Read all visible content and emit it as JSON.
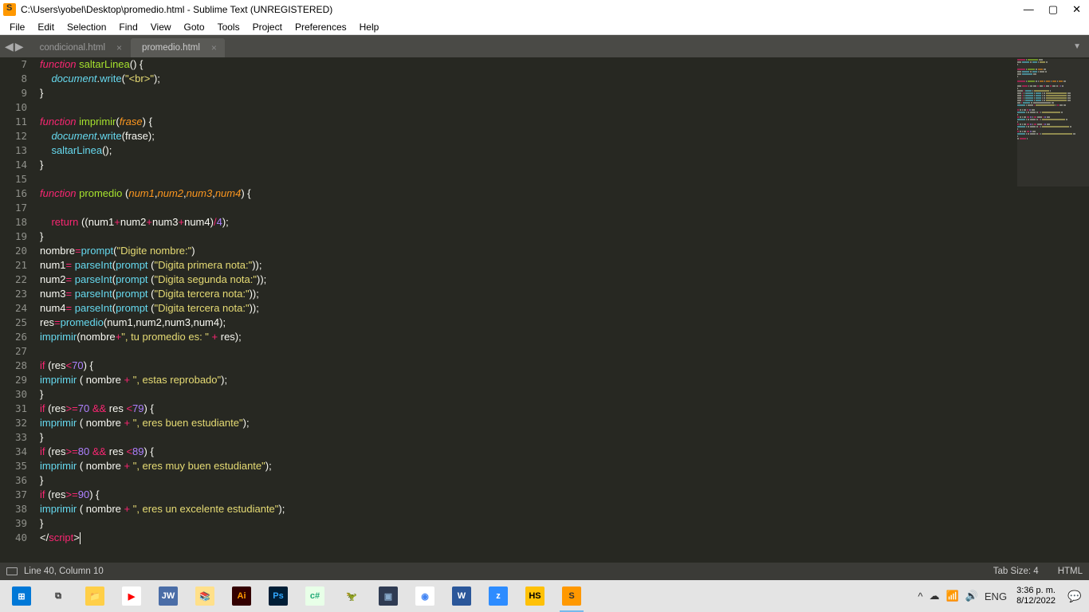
{
  "window": {
    "title": "C:\\Users\\yobel\\Desktop\\promedio.html - Sublime Text (UNREGISTERED)"
  },
  "menu": [
    "File",
    "Edit",
    "Selection",
    "Find",
    "View",
    "Goto",
    "Tools",
    "Project",
    "Preferences",
    "Help"
  ],
  "tabs": [
    {
      "label": "condicional.html",
      "active": false
    },
    {
      "label": "promedio.html",
      "active": true
    }
  ],
  "gutter_start": 7,
  "gutter_end": 40,
  "code_lines": [
    [
      [
        "kw",
        "function"
      ],
      [
        "var",
        " "
      ],
      [
        "fnname",
        "saltarLinea"
      ],
      [
        "paren",
        "() {"
      ]
    ],
    [
      [
        "var",
        "    "
      ],
      [
        "obj",
        "document"
      ],
      [
        "var",
        "."
      ],
      [
        "fn",
        "write"
      ],
      [
        "paren",
        "("
      ],
      [
        "str",
        "\"<br>\""
      ],
      [
        "paren",
        ");"
      ]
    ],
    [
      [
        "paren",
        "}"
      ]
    ],
    [],
    [
      [
        "kw",
        "function"
      ],
      [
        "var",
        " "
      ],
      [
        "fnname",
        "imprimir"
      ],
      [
        "paren",
        "("
      ],
      [
        "param",
        "frase"
      ],
      [
        "paren",
        ") {"
      ]
    ],
    [
      [
        "var",
        "    "
      ],
      [
        "obj",
        "document"
      ],
      [
        "var",
        "."
      ],
      [
        "fn",
        "write"
      ],
      [
        "paren",
        "("
      ],
      [
        "var",
        "frase"
      ],
      [
        "paren",
        ");"
      ]
    ],
    [
      [
        "var",
        "    "
      ],
      [
        "fn",
        "saltarLinea"
      ],
      [
        "paren",
        "();"
      ]
    ],
    [
      [
        "paren",
        "}"
      ]
    ],
    [],
    [
      [
        "kw",
        "function"
      ],
      [
        "var",
        " "
      ],
      [
        "fnname",
        "promedio"
      ],
      [
        "var",
        " "
      ],
      [
        "paren",
        "("
      ],
      [
        "param",
        "num1"
      ],
      [
        "var",
        ","
      ],
      [
        "param",
        "num2"
      ],
      [
        "var",
        ","
      ],
      [
        "param",
        "num3"
      ],
      [
        "var",
        ","
      ],
      [
        "param",
        "num4"
      ],
      [
        "paren",
        ") {"
      ]
    ],
    [],
    [
      [
        "var",
        "    "
      ],
      [
        "kw2",
        "return"
      ],
      [
        "var",
        " "
      ],
      [
        "paren",
        "(("
      ],
      [
        "var",
        "num1"
      ],
      [
        "op",
        "+"
      ],
      [
        "var",
        "num2"
      ],
      [
        "op",
        "+"
      ],
      [
        "var",
        "num3"
      ],
      [
        "op",
        "+"
      ],
      [
        "var",
        "num4"
      ],
      [
        "paren",
        ")"
      ],
      [
        "op",
        "/"
      ],
      [
        "num",
        "4"
      ],
      [
        "paren",
        ");"
      ]
    ],
    [
      [
        "paren",
        "}"
      ]
    ],
    [
      [
        "var",
        "nombre"
      ],
      [
        "op",
        "="
      ],
      [
        "fn",
        "prompt"
      ],
      [
        "paren",
        "("
      ],
      [
        "str",
        "\"Digite nombre:\""
      ],
      [
        "paren",
        ")"
      ]
    ],
    [
      [
        "var",
        "num1"
      ],
      [
        "op",
        "="
      ],
      [
        "var",
        " "
      ],
      [
        "fn",
        "parseInt"
      ],
      [
        "paren",
        "("
      ],
      [
        "fn",
        "prompt"
      ],
      [
        "var",
        " "
      ],
      [
        "paren",
        "("
      ],
      [
        "str",
        "\"Digita primera nota:\""
      ],
      [
        "paren",
        "));"
      ]
    ],
    [
      [
        "var",
        "num2"
      ],
      [
        "op",
        "="
      ],
      [
        "var",
        " "
      ],
      [
        "fn",
        "parseInt"
      ],
      [
        "paren",
        "("
      ],
      [
        "fn",
        "prompt"
      ],
      [
        "var",
        " "
      ],
      [
        "paren",
        "("
      ],
      [
        "str",
        "\"Digita segunda nota:\""
      ],
      [
        "paren",
        "));"
      ]
    ],
    [
      [
        "var",
        "num3"
      ],
      [
        "op",
        "="
      ],
      [
        "var",
        " "
      ],
      [
        "fn",
        "parseInt"
      ],
      [
        "paren",
        "("
      ],
      [
        "fn",
        "prompt"
      ],
      [
        "var",
        " "
      ],
      [
        "paren",
        "("
      ],
      [
        "str",
        "\"Digita tercera nota:\""
      ],
      [
        "paren",
        "));"
      ]
    ],
    [
      [
        "var",
        "num4"
      ],
      [
        "op",
        "="
      ],
      [
        "var",
        " "
      ],
      [
        "fn",
        "parseInt"
      ],
      [
        "paren",
        "("
      ],
      [
        "fn",
        "prompt"
      ],
      [
        "var",
        " "
      ],
      [
        "paren",
        "("
      ],
      [
        "str",
        "\"Digita tercera nota:\""
      ],
      [
        "paren",
        "));"
      ]
    ],
    [
      [
        "var",
        "res"
      ],
      [
        "op",
        "="
      ],
      [
        "fn",
        "promedio"
      ],
      [
        "paren",
        "("
      ],
      [
        "var",
        "num1,num2,num3,num4"
      ],
      [
        "paren",
        ");"
      ]
    ],
    [
      [
        "fn",
        "imprimir"
      ],
      [
        "paren",
        "("
      ],
      [
        "var",
        "nombre"
      ],
      [
        "op",
        "+"
      ],
      [
        "str",
        "\", tu promedio es: \""
      ],
      [
        "var",
        " "
      ],
      [
        "op",
        "+"
      ],
      [
        "var",
        " res"
      ],
      [
        "paren",
        ");"
      ]
    ],
    [],
    [
      [
        "kw2",
        "if"
      ],
      [
        "var",
        " "
      ],
      [
        "paren",
        "("
      ],
      [
        "var",
        "res"
      ],
      [
        "op",
        "<"
      ],
      [
        "num",
        "70"
      ],
      [
        "paren",
        ") {"
      ]
    ],
    [
      [
        "fn",
        "imprimir"
      ],
      [
        "var",
        " "
      ],
      [
        "paren",
        "( "
      ],
      [
        "var",
        "nombre"
      ],
      [
        "var",
        " "
      ],
      [
        "op",
        "+"
      ],
      [
        "var",
        " "
      ],
      [
        "str",
        "\", estas reprobado\""
      ],
      [
        "paren",
        ");"
      ]
    ],
    [
      [
        "paren",
        "}"
      ]
    ],
    [
      [
        "kw2",
        "if"
      ],
      [
        "var",
        " "
      ],
      [
        "paren",
        "("
      ],
      [
        "var",
        "res"
      ],
      [
        "op",
        ">="
      ],
      [
        "num",
        "70"
      ],
      [
        "var",
        " "
      ],
      [
        "op",
        "&&"
      ],
      [
        "var",
        " res "
      ],
      [
        "op",
        "<"
      ],
      [
        "num",
        "79"
      ],
      [
        "paren",
        ") {"
      ]
    ],
    [
      [
        "fn",
        "imprimir"
      ],
      [
        "var",
        " "
      ],
      [
        "paren",
        "( "
      ],
      [
        "var",
        "nombre"
      ],
      [
        "var",
        " "
      ],
      [
        "op",
        "+"
      ],
      [
        "var",
        " "
      ],
      [
        "str",
        "\", eres buen estudiante\""
      ],
      [
        "paren",
        ");"
      ]
    ],
    [
      [
        "paren",
        "}"
      ]
    ],
    [
      [
        "kw2",
        "if"
      ],
      [
        "var",
        " "
      ],
      [
        "paren",
        "("
      ],
      [
        "var",
        "res"
      ],
      [
        "op",
        ">="
      ],
      [
        "num",
        "80"
      ],
      [
        "var",
        " "
      ],
      [
        "op",
        "&&"
      ],
      [
        "var",
        " res "
      ],
      [
        "op",
        "<"
      ],
      [
        "num",
        "89"
      ],
      [
        "paren",
        ") {"
      ]
    ],
    [
      [
        "fn",
        "imprimir"
      ],
      [
        "var",
        " "
      ],
      [
        "paren",
        "( "
      ],
      [
        "var",
        "nombre"
      ],
      [
        "var",
        " "
      ],
      [
        "op",
        "+"
      ],
      [
        "var",
        " "
      ],
      [
        "str",
        "\", eres muy buen estudiante\""
      ],
      [
        "paren",
        ");"
      ]
    ],
    [
      [
        "paren",
        "}"
      ]
    ],
    [
      [
        "kw2",
        "if"
      ],
      [
        "var",
        " "
      ],
      [
        "paren",
        "("
      ],
      [
        "var",
        "res"
      ],
      [
        "op",
        ">="
      ],
      [
        "num",
        "90"
      ],
      [
        "paren",
        ") {"
      ]
    ],
    [
      [
        "fn",
        "imprimir"
      ],
      [
        "var",
        " "
      ],
      [
        "paren",
        "( "
      ],
      [
        "var",
        "nombre"
      ],
      [
        "var",
        " "
      ],
      [
        "op",
        "+"
      ],
      [
        "var",
        " "
      ],
      [
        "str",
        "\", eres un excelente estudiante\""
      ],
      [
        "paren",
        ");"
      ]
    ],
    [
      [
        "paren",
        "}"
      ]
    ],
    [
      [
        "tagbr",
        "</"
      ],
      [
        "tag",
        "script"
      ],
      [
        "tagbr",
        ">"
      ],
      [
        "cursor",
        ""
      ]
    ]
  ],
  "status": {
    "left": "Line 40, Column 10",
    "tab_size": "Tab Size: 4",
    "syntax": "HTML"
  },
  "tray": {
    "lang": "ENG",
    "time": "3:36 p. m.",
    "date": "8/12/2022"
  },
  "taskbar_icons": [
    {
      "name": "start",
      "bg": "#0078d7",
      "fg": "#fff",
      "txt": "⊞"
    },
    {
      "name": "taskview",
      "bg": "transparent",
      "fg": "#333",
      "txt": "⧉"
    },
    {
      "name": "explorer",
      "bg": "#ffcf48",
      "fg": "#5a3",
      "txt": "📁"
    },
    {
      "name": "youtube",
      "bg": "#fff",
      "fg": "#ff0000",
      "txt": "▶"
    },
    {
      "name": "jw",
      "bg": "#4a6da7",
      "fg": "#fff",
      "txt": "JW"
    },
    {
      "name": "books",
      "bg": "#ffe08a",
      "fg": "#8a5",
      "txt": "📚"
    },
    {
      "name": "illustrator",
      "bg": "#330000",
      "fg": "#ff9a00",
      "txt": "Ai"
    },
    {
      "name": "photoshop",
      "bg": "#001e36",
      "fg": "#31a8ff",
      "txt": "Ps"
    },
    {
      "name": "codeblocks",
      "bg": "#e8ffe8",
      "fg": "#2a7",
      "txt": "c#"
    },
    {
      "name": "dev",
      "bg": "transparent",
      "fg": "#2a7",
      "txt": "🦖"
    },
    {
      "name": "virtualbox",
      "bg": "#2f3b52",
      "fg": "#8ac",
      "txt": "▣"
    },
    {
      "name": "chrome",
      "bg": "#fff",
      "fg": "#4285f4",
      "txt": "◉"
    },
    {
      "name": "word",
      "bg": "#2b579a",
      "fg": "#fff",
      "txt": "W"
    },
    {
      "name": "zoom",
      "bg": "#2d8cff",
      "fg": "#fff",
      "txt": "z"
    },
    {
      "name": "hs",
      "bg": "#ffc107",
      "fg": "#000",
      "txt": "HS"
    },
    {
      "name": "sublime",
      "bg": "#ff9800",
      "fg": "#333",
      "txt": "S",
      "active": true
    }
  ]
}
